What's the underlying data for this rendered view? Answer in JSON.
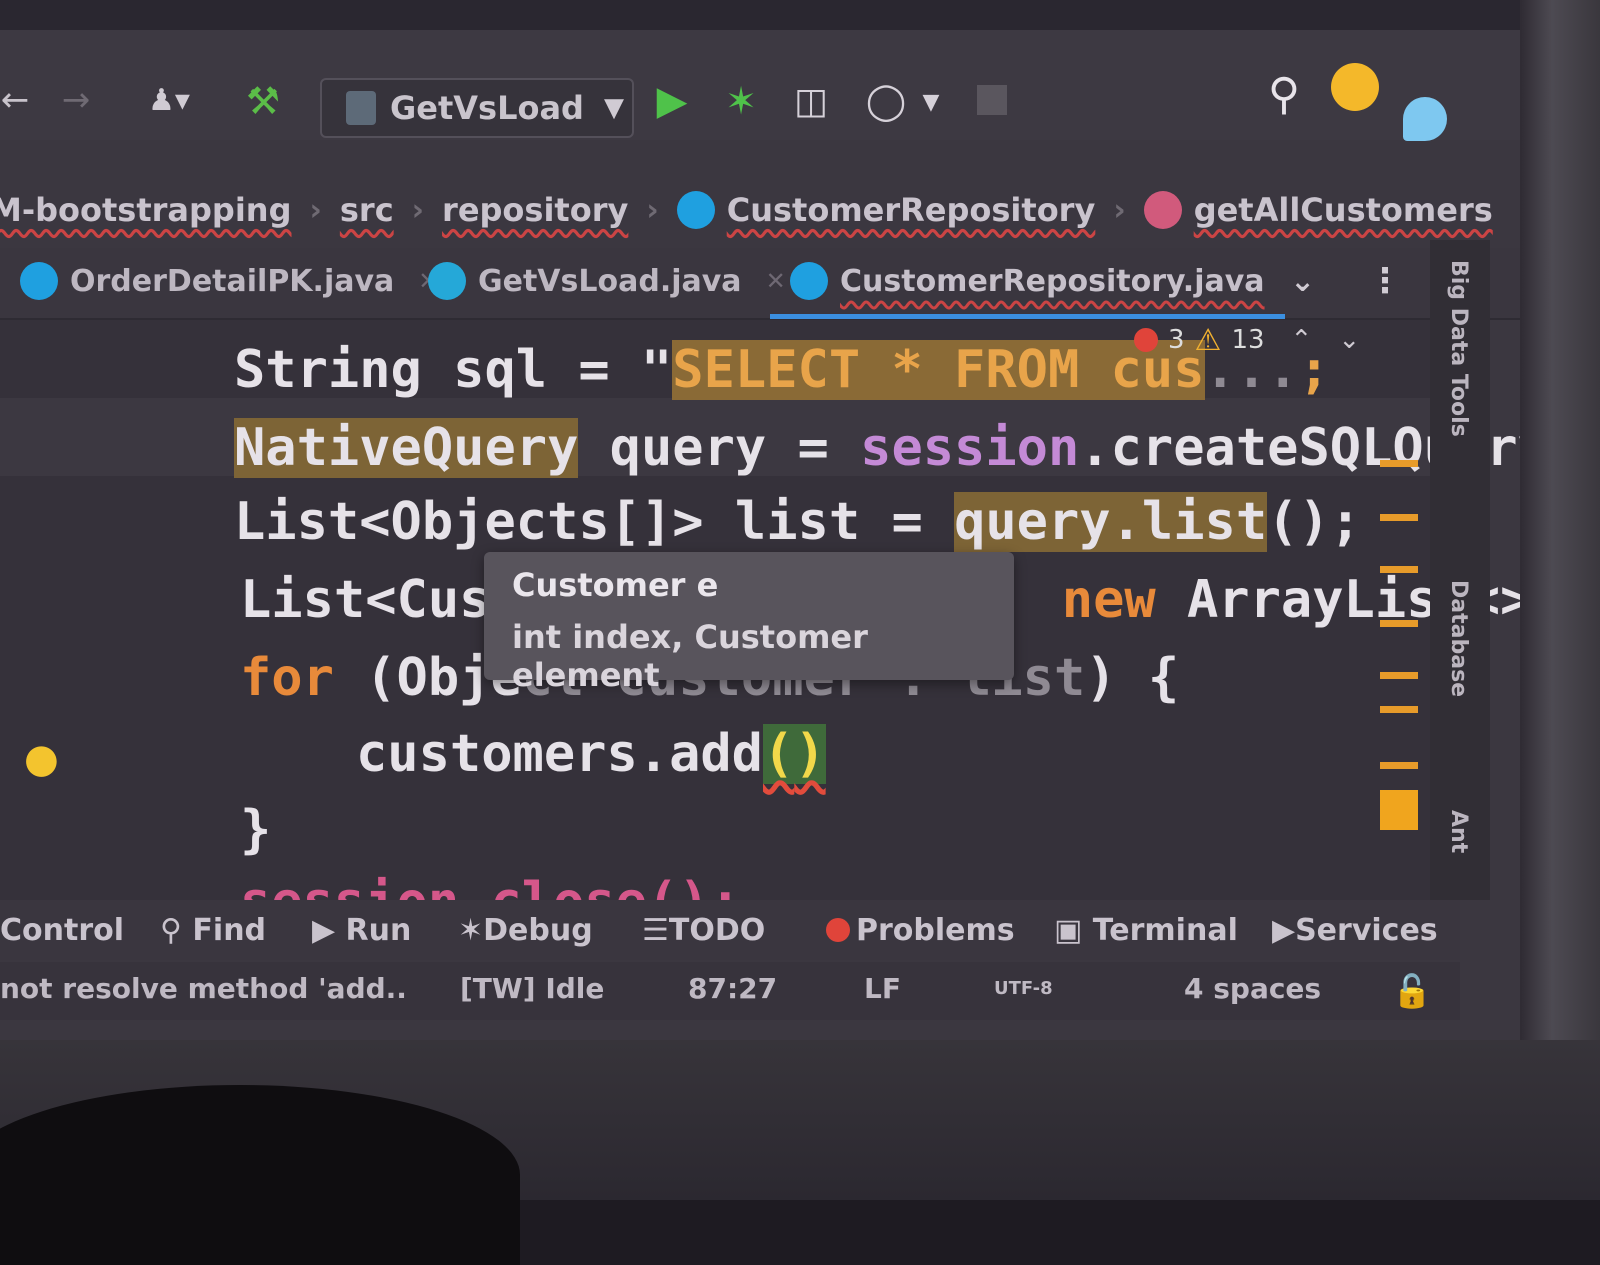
{
  "toolbar": {
    "run_config": "GetVsLoad"
  },
  "breadcrumb": {
    "project": "M-bootstrapping",
    "src": "src",
    "package": "repository",
    "class": "CustomerRepository",
    "method": "getAllCustomers"
  },
  "tabs": [
    {
      "label": "OrderDetailPK.java"
    },
    {
      "label": "GetVsLoad.java"
    },
    {
      "label": "CustomerRepository.java"
    }
  ],
  "inspection": {
    "errors": "3",
    "warnings": "13"
  },
  "code": {
    "line1": {
      "a": "String sql = \"",
      "b": "SELECT * FROM cus",
      "c": "...",
      "d": ";"
    },
    "line2": {
      "a": "NativeQuery",
      "b": " query = ",
      "c": "session",
      "d": ".createSQLQuery"
    },
    "line3": {
      "a": "List<Objects[]> list = ",
      "b": "query.list",
      "c": "();"
    },
    "line4": {
      "a": "List<Cust",
      "b": "new",
      "c": " ArrayList<>"
    },
    "line5": {
      "a": "for",
      "b": " (Obje",
      "c": "ct customer : list",
      "d": ") {"
    },
    "line6": {
      "a": "customers.add",
      "b": "(",
      "c": ")"
    },
    "line7": {
      "a": "}"
    },
    "line8": {
      "a": "session.close();"
    }
  },
  "tooltip": {
    "param1": "Customer e",
    "param2": "int index, Customer element"
  },
  "right_tools": {
    "big_data": "Big Data Tools",
    "database": "Database",
    "ant": "Ant"
  },
  "tool_windows": {
    "control": "Control",
    "find": "Find",
    "run": "Run",
    "debug": "Debug",
    "todo": "TODO",
    "problems": "Problems",
    "terminal": "Terminal",
    "services": "Services"
  },
  "status": {
    "message": "not resolve method 'add..",
    "tw": "[TW] Idle",
    "position": "87:27",
    "line_sep": "LF",
    "encoding": "UTF-8",
    "indent": "4 spaces"
  },
  "colors": {
    "keyword": "#e88a3a",
    "field": "#c48ad6",
    "accent": "#3b8fe0",
    "error": "#e24c3c",
    "warning": "#f0b030"
  }
}
